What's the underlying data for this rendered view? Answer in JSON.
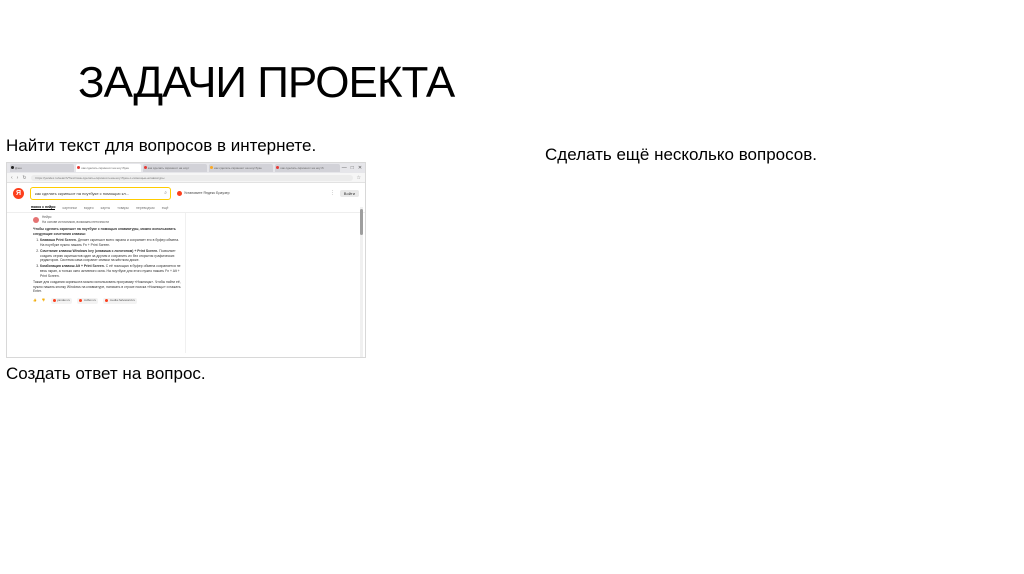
{
  "slide": {
    "title": "ЗАДАЧИ ПРОЕКТА",
    "tasks": {
      "find_text": "Найти текст для вопросов в интернете.",
      "more_questions": "Сделать ещё несколько вопросов.",
      "create_answer": "Создать ответ на вопрос."
    }
  },
  "screenshot": {
    "tabs": [
      {
        "label": "Дзен",
        "color": "#222222"
      },
      {
        "label": "как сделать скриншот на ноутбуке",
        "color": "#e53935"
      },
      {
        "label": "как сделать скриншот на ноут",
        "color": "#e53935"
      },
      {
        "label": "как сделать скриншот на ноутбуке",
        "color": "#f9a825"
      },
      {
        "label": "как сделать скриншот на ноутб",
        "color": "#e53935"
      }
    ],
    "window_buttons": [
      "—",
      "□",
      "✕"
    ],
    "url": "https://yandex.ru/search/?text=как+сделать+скриншот+на+ноутбуке+с+помощью+клавиатуры",
    "logo_letter": "Я",
    "search_query": "как сделать скриншот на ноутбуке с помощью кл...",
    "promo_text": "Установите Яндекс Браузер",
    "login_label": "Войти",
    "service_tabs": [
      "поиск с нейро",
      "картинки",
      "видео",
      "карты",
      "товары",
      "переводчик",
      "ещё"
    ],
    "answer": {
      "source_name": "Нейро",
      "source_sub": "На основе источников, возможны неточности",
      "intro": "Чтобы сделать скриншот на ноутбуке с помощью клавиатуры, можно использовать следующие сочетания клавиш:",
      "items": [
        {
          "bold": "Клавиша Print Screen.",
          "text": "Делает скриншот всего экрана и сохраняет его в буфер обмена. На ноутбуке нужно нажать Fn + Print Screen."
        },
        {
          "bold": "Сочетание клавиш Windows key (клавиша с логотипом) + Print Screen.",
          "text": "Позволяет создать серию скриншотов один за другим и сохранить их без открытия графических редакторов. Система сама сохранит снимки на жёстком диске."
        },
        {
          "bold": "Комбинация клавиш Alt + Print Screen.",
          "text": "С её помощью в буфер обмена сохраняется не весь экран, а только окно активного окна. На ноутбуке для этого нужно нажать Fn + Alt + Print Screen."
        }
      ],
      "outro": "Также для создания скриншота можно использовать программу «Ножницы». Чтобы найти её, нужно нажать кнопку Windows на клавиатуре, написать в строке поиска «Ножницы» и нажать Enter.",
      "sources": [
        "yandex.ru",
        "mdbox.ru",
        "media.halvacard.ru"
      ]
    }
  }
}
